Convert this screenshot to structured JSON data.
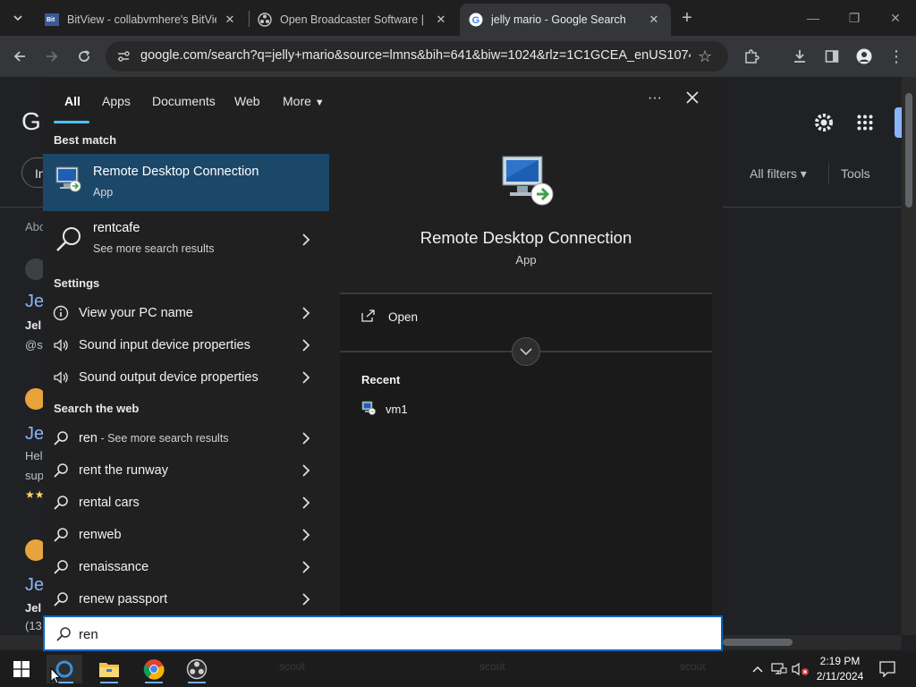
{
  "browser": {
    "tabs": [
      {
        "title": "BitView - collabvmhere's BitVie",
        "favicon": "bitview-favicon"
      },
      {
        "title": "Open Broadcaster Software | O",
        "favicon": "obs-favicon"
      },
      {
        "title": "jelly mario - Google Search",
        "favicon": "google-favicon",
        "active": true
      }
    ],
    "url": "google.com/search?q=jelly+mario&source=lmns&bih=641&biw=1024&rlz=1C1GCEA_enUS1074..."
  },
  "google": {
    "logo_letter": "G",
    "filter_chip": "In",
    "all_filters": "All filters",
    "tools": "Tools",
    "about": "Abo",
    "results": [
      {
        "title": "Je",
        "line1": "Jel",
        "line2": "@s"
      },
      {
        "title": "Je",
        "line1": "Hel",
        "line2": "sup",
        "stars": "★★"
      },
      {
        "title": "Je",
        "line1": "Jel",
        "line2": "(13"
      }
    ]
  },
  "search": {
    "tabs": [
      "All",
      "Apps",
      "Documents",
      "Web",
      "More"
    ],
    "more_glyph": "···",
    "best_match_header": "Best match",
    "best_match": {
      "name": "Remote Desktop Connection",
      "type": "App"
    },
    "more_result": {
      "name": "rentcafe",
      "sub": "See more search results"
    },
    "settings_header": "Settings",
    "settings": [
      "View your PC name",
      "Sound input device properties",
      "Sound output device properties"
    ],
    "web_header": "Search the web",
    "web_first": {
      "term": "ren",
      "sub": " - See more search results"
    },
    "web": [
      "rent the runway",
      "rental cars",
      "renweb",
      "renaissance",
      "renew passport"
    ],
    "preview": {
      "title": "Remote Desktop Connection",
      "type": "App",
      "open": "Open",
      "recent_header": "Recent",
      "recent": [
        "vm1"
      ]
    },
    "query": "ren"
  },
  "taskbar": {
    "time": "2:19 PM",
    "date": "2/11/2024",
    "ghost_labels": [
      "scout",
      "scout",
      "scout"
    ]
  }
}
